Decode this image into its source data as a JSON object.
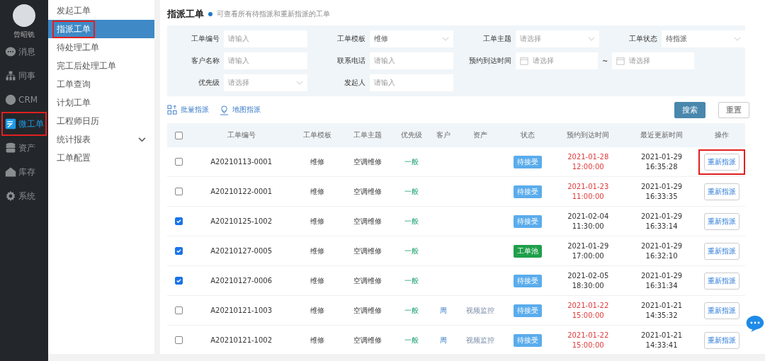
{
  "user": {
    "name": "曾昭铣"
  },
  "nav": [
    {
      "label": "消息",
      "selected": false,
      "highlighted": false
    },
    {
      "label": "同事",
      "selected": false,
      "highlighted": false
    },
    {
      "label": "CRM",
      "selected": false,
      "highlighted": false
    },
    {
      "label": "微工单",
      "selected": true,
      "highlighted": true
    },
    {
      "label": "资产",
      "selected": false,
      "highlighted": false
    },
    {
      "label": "库存",
      "selected": false,
      "highlighted": false
    },
    {
      "label": "系统",
      "selected": false,
      "highlighted": false
    }
  ],
  "submenu": [
    {
      "label": "发起工单",
      "selected": false,
      "highlighted": false,
      "kind": "link"
    },
    {
      "label": "指派工单",
      "selected": true,
      "highlighted": true,
      "kind": "link"
    },
    {
      "label": "待处理工单",
      "selected": false,
      "highlighted": false,
      "kind": "link"
    },
    {
      "label": "完工后处理工单",
      "selected": false,
      "highlighted": false,
      "kind": "link"
    },
    {
      "label": "工单查询",
      "selected": false,
      "highlighted": false,
      "kind": "link"
    },
    {
      "label": "计划工单",
      "selected": false,
      "highlighted": false,
      "kind": "link"
    },
    {
      "label": "工程师日历",
      "selected": false,
      "highlighted": false,
      "kind": "link"
    },
    {
      "label": "统计报表",
      "selected": false,
      "highlighted": false,
      "kind": "group"
    },
    {
      "label": "工单配置",
      "selected": false,
      "highlighted": false,
      "kind": "link"
    }
  ],
  "page": {
    "title": "指派工单",
    "subtitle": "可查看所有待指派和重新指派的工单"
  },
  "filters": [
    {
      "label": "工单编号",
      "kind": "text",
      "placeholder": "请输入"
    },
    {
      "label": "工单模板",
      "kind": "select",
      "value": "维修"
    },
    {
      "label": "工单主题",
      "kind": "select",
      "placeholder": "请选择"
    },
    {
      "label": "工单状态",
      "kind": "select",
      "value": "待指派"
    },
    {
      "label": "客户名称",
      "kind": "text",
      "placeholder": "请输入"
    },
    {
      "label": "联系电话",
      "kind": "text",
      "placeholder": "请输入"
    },
    {
      "label": "预约到达时间",
      "kind": "date_range",
      "placeholder": "请选择",
      "separator": "~",
      "placeholder_end": "请选择"
    },
    {
      "label": "优先级",
      "kind": "select",
      "placeholder": "请选择"
    },
    {
      "label": "发起人",
      "kind": "text",
      "placeholder": "请输入"
    }
  ],
  "actions": [
    {
      "label": "批量指派"
    },
    {
      "label": "地图指派"
    }
  ],
  "buttons": [
    {
      "label": "搜索",
      "kind": "primary"
    },
    {
      "label": "重置",
      "kind": "default"
    }
  ],
  "table": {
    "select_all": {
      "checked": false
    },
    "columns": [
      "工单编号",
      "工单模板",
      "工单主题",
      "优先级",
      "客户",
      "资产",
      "状态",
      "预约到达时间",
      "最近更新时间",
      "操作"
    ],
    "rows": [
      {
        "checked": false,
        "id": "A20210113-0001",
        "template": "维修",
        "subject": "空调维修",
        "priority": "一般",
        "status": {
          "text": "待接受",
          "kind": "pending"
        },
        "appt_date": "2021-01-28",
        "appt_time": "12:00:00",
        "overdue": true,
        "upd_date": "2021-01-29",
        "upd_time": "16:35:28",
        "action": "重新指派",
        "highlighted": true
      },
      {
        "checked": false,
        "id": "A20210122-0001",
        "template": "维修",
        "subject": "空调维修",
        "priority": "一般",
        "status": {
          "text": "待接受",
          "kind": "pending"
        },
        "appt_date": "2021-01-23",
        "appt_time": "11:00:00",
        "overdue": true,
        "upd_date": "2021-01-29",
        "upd_time": "16:33:35",
        "action": "重新指派",
        "highlighted": false
      },
      {
        "checked": true,
        "id": "A20210125-1002",
        "template": "维修",
        "subject": "空调维修",
        "priority": "一般",
        "status": {
          "text": "待接受",
          "kind": "pending"
        },
        "appt_date": "2021-02-04",
        "appt_time": "11:30:00",
        "overdue": false,
        "upd_date": "2021-01-29",
        "upd_time": "16:33:14",
        "action": "重新指派",
        "highlighted": false
      },
      {
        "checked": true,
        "id": "A20210127-0005",
        "template": "维修",
        "subject": "空调维修",
        "priority": "一般",
        "status": {
          "text": "工单池",
          "kind": "pool"
        },
        "appt_date": "2021-01-29",
        "appt_time": "17:00:00",
        "overdue": false,
        "upd_date": "2021-01-29",
        "upd_time": "16:32:10",
        "action": "重新指派",
        "highlighted": false
      },
      {
        "checked": true,
        "id": "A20210127-0006",
        "template": "维修",
        "subject": "空调维修",
        "priority": "一般",
        "status": {
          "text": "待接受",
          "kind": "pending"
        },
        "appt_date": "2021-02-05",
        "appt_time": "18:30:00",
        "overdue": false,
        "upd_date": "2021-01-29",
        "upd_time": "16:31:34",
        "action": "重新指派",
        "highlighted": false
      },
      {
        "checked": false,
        "id": "A20210121-1003",
        "template": "维修",
        "subject": "空调维修",
        "priority": "一般",
        "customer": "周",
        "asset": "视频监控",
        "status": {
          "text": "待接受",
          "kind": "pending"
        },
        "appt_date": "2021-01-22",
        "appt_time": "15:00:00",
        "overdue": true,
        "upd_date": "2021-01-21",
        "upd_time": "14:35:32",
        "action": "重新指派",
        "highlighted": false
      },
      {
        "checked": false,
        "id": "A20210121-1002",
        "template": "维修",
        "subject": "空调维修",
        "priority": "一般",
        "customer": "周",
        "asset": "视频监控",
        "status": {
          "text": "待接受",
          "kind": "pending"
        },
        "appt_date": "2021-01-22",
        "appt_time": "15:00:00",
        "overdue": true,
        "upd_date": "2021-01-21",
        "upd_time": "14:33:41",
        "action": "重新指派",
        "highlighted": false
      }
    ]
  }
}
